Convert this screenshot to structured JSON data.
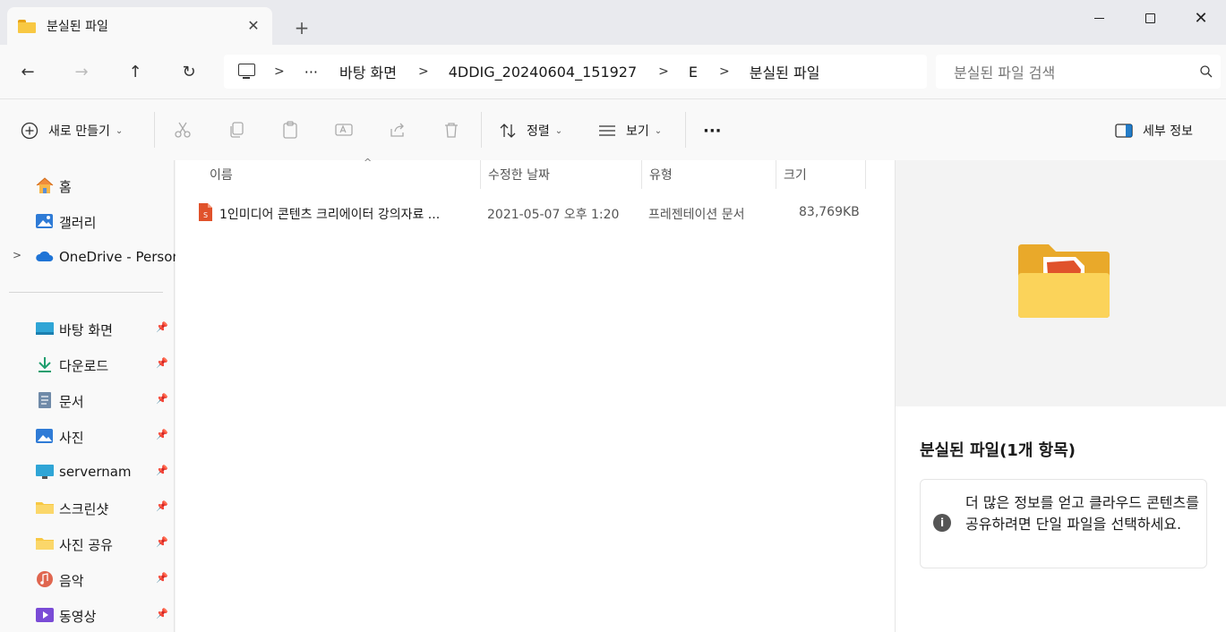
{
  "window": {
    "tab_title": "분실된 파일",
    "close_tab": "✕",
    "new_tab": "+",
    "minimize": "",
    "maximize": "",
    "close": "✕"
  },
  "nav": {
    "back": "←",
    "forward": "→",
    "up": "↑",
    "refresh": "↻"
  },
  "address": {
    "overflow": "···",
    "separator": ">",
    "crumbs": [
      "바탕 화면",
      "4DDIG_20240604_151927",
      "E",
      "분실된 파일"
    ]
  },
  "search": {
    "placeholder": "분실된 파일 검색"
  },
  "toolbar": {
    "new_label": "새로 만들기",
    "sort_label": "정렬",
    "view_label": "보기",
    "more_label": "···",
    "details_label": "세부 정보"
  },
  "sidebar": {
    "home": "홈",
    "gallery": "갤러리",
    "onedrive": "OneDrive - Person",
    "expander": ">",
    "pinned": [
      {
        "label": "바탕 화면",
        "icon": "desktop-icon"
      },
      {
        "label": "다운로드",
        "icon": "download-icon"
      },
      {
        "label": "문서",
        "icon": "document-icon"
      },
      {
        "label": "사진",
        "icon": "pictures-icon"
      },
      {
        "label": "servernam",
        "icon": "monitor-icon"
      },
      {
        "label": "스크린샷",
        "icon": "folder-icon"
      },
      {
        "label": "사진 공유",
        "icon": "folder-icon"
      },
      {
        "label": "음악",
        "icon": "music-icon"
      },
      {
        "label": "동영상",
        "icon": "video-icon"
      }
    ]
  },
  "filelist": {
    "columns": {
      "name": "이름",
      "date": "수정한 날짜",
      "type": "유형",
      "size": "크기"
    },
    "sort_caret": "^",
    "rows": [
      {
        "name": "1인미디어 콘텐츠 크리에이터 강의자료 ...",
        "date": "2021-05-07 오후 1:20",
        "type": "프레젠테이션 문서",
        "size": "83,769KB"
      }
    ]
  },
  "details": {
    "title": "분실된 파일(1개 항목)",
    "info_icon": "i",
    "info_text": "더 많은 정보를 얻고 클라우드 콘텐츠를 공유하려면 단일 파일을 선택하세요."
  },
  "colors": {
    "accent": "#0067c0",
    "folder_yellow": "#f8c843",
    "ppt_orange": "#e0522b"
  }
}
